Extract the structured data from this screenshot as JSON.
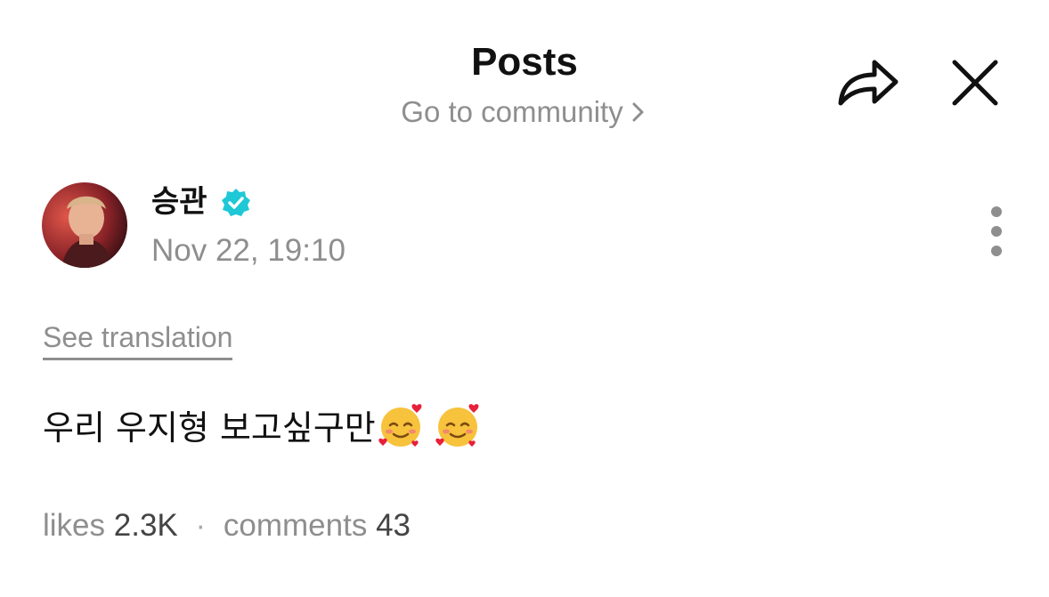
{
  "header": {
    "title": "Posts",
    "community_link": "Go to community"
  },
  "post": {
    "author": {
      "name": "승관",
      "verified": true
    },
    "timestamp": "Nov 22, 19:10",
    "see_translation": "See translation",
    "body_text": "우리 우지형 보고싶구만",
    "emoji": [
      "smiling-face-with-hearts",
      "smiling-face-with-hearts"
    ],
    "stats": {
      "likes_label": "likes",
      "likes_value": "2.3K",
      "separator": "·",
      "comments_label": "comments",
      "comments_value": "43"
    }
  },
  "colors": {
    "verified_badge": "#1ec8d6",
    "muted_text": "#8e8e8e",
    "primary_text": "#111111"
  },
  "icons": {
    "share": "share-arrow-icon",
    "close": "close-x-icon",
    "more": "vertical-ellipsis-icon",
    "chevron": "chevron-right-icon",
    "verified": "verified-badge-icon"
  }
}
